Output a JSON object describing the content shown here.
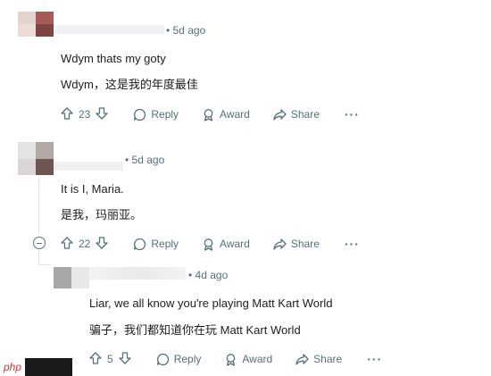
{
  "comments": [
    {
      "time": "• 5d ago",
      "lines": [
        "Wdym thats my goty",
        "Wdym，这是我的年度最佳"
      ],
      "actions": {
        "votes": "23",
        "reply": "Reply",
        "award": "Award",
        "share": "Share",
        "more": "···"
      }
    },
    {
      "time": "• 5d ago",
      "lines": [
        "It is I, Maria.",
        "是我，玛丽亚。"
      ],
      "actions": {
        "votes": "22",
        "reply": "Reply",
        "award": "Award",
        "share": "Share",
        "more": "···"
      }
    },
    {
      "time": "• 4d ago",
      "lines": [
        "Liar, we all know you're playing Matt Kart World",
        "骗子，我们都知道你在玩 Matt Kart World"
      ],
      "actions": {
        "votes": "5",
        "reply": "Reply",
        "award": "Award",
        "share": "Share",
        "more": "···"
      }
    }
  ],
  "watermark": {
    "text": "php"
  },
  "colors": {
    "meta": "#576f76",
    "text": "#1c1c1c",
    "thread": "#dfe3e5"
  }
}
